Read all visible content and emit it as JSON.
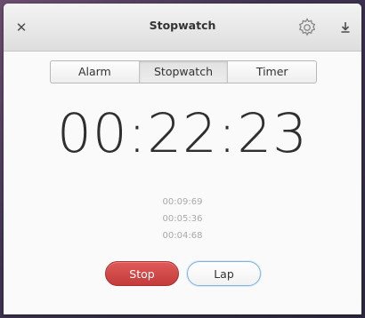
{
  "window": {
    "title": "Stopwatch",
    "close_icon": "close-icon",
    "settings_icon": "gear-icon",
    "download_icon": "download-icon"
  },
  "mode_switch": {
    "items": [
      {
        "label": "Alarm",
        "active": false
      },
      {
        "label": "Stopwatch",
        "active": true
      },
      {
        "label": "Timer",
        "active": false
      }
    ]
  },
  "stopwatch": {
    "time": "00:22:23",
    "laps": [
      "00:09:69",
      "00:05:36",
      "00:04:68"
    ]
  },
  "buttons": {
    "stop_label": "Stop",
    "lap_label": "Lap"
  },
  "colors": {
    "stop_button": "#d44747",
    "lap_button_border": "#7fb4e0"
  }
}
